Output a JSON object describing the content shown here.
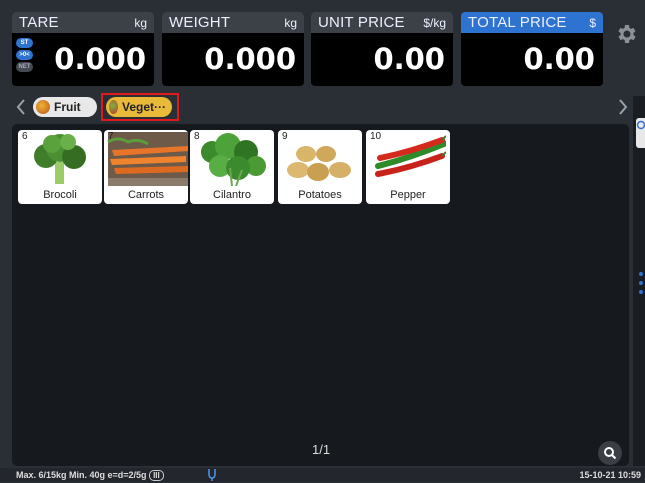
{
  "readouts": [
    {
      "title": "TARE",
      "unit": "kg",
      "value": "0.000"
    },
    {
      "title": "WEIGHT",
      "unit": "kg",
      "value": "0.000"
    },
    {
      "title": "UNIT PRICE",
      "unit": "$/kg",
      "value": "0.00"
    },
    {
      "title": "TOTAL PRICE",
      "unit": "$",
      "value": "0.00"
    }
  ],
  "tare_tags": [
    "ST",
    ">0<",
    "NET"
  ],
  "categories": [
    {
      "label": "Fruit",
      "icon": "fruit-icon"
    },
    {
      "label": "Veget···",
      "icon": "vegetable-icon",
      "selected": true
    }
  ],
  "products": [
    {
      "number": "6",
      "name": "Brocoli",
      "icon": "broccoli-image"
    },
    {
      "number": "7",
      "name": "Carrots",
      "icon": "carrots-image"
    },
    {
      "number": "8",
      "name": "Cilantro",
      "icon": "cilantro-image"
    },
    {
      "number": "9",
      "name": "Potatoes",
      "icon": "potatoes-image"
    },
    {
      "number": "10",
      "name": "Pepper",
      "icon": "pepper-image"
    }
  ],
  "pager": "1/1",
  "status": {
    "spec": "Max. 6/15kg  Min. 40g  e=d=2/5g",
    "class_mark": "III",
    "datetime": "15-10-21 10:59"
  },
  "colors": {
    "accent": "#2f73d1",
    "selected_category": "#e9b93a",
    "highlight": "#e0191f"
  }
}
